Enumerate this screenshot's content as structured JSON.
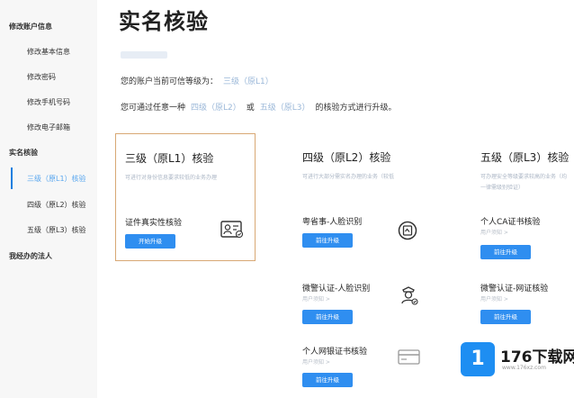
{
  "sidebar": {
    "groups": [
      {
        "label": "修改账户信息"
      },
      {
        "label": "实名核验"
      },
      {
        "label": "我经办的法人"
      }
    ],
    "account_items": [
      {
        "label": "修改基本信息"
      },
      {
        "label": "修改密码"
      },
      {
        "label": "修改手机号码"
      },
      {
        "label": "修改电子邮箱"
      }
    ],
    "verify_items": [
      {
        "label": "三级（原L1）核验"
      },
      {
        "label": "四级（原L2）核验"
      },
      {
        "label": "五级（原L3）核验"
      }
    ]
  },
  "main": {
    "title": "实名核验",
    "line1_prefix": "您的账户当前可信等级为：",
    "line1_level": "三级（原L1）",
    "line2_prefix": "您可通过任意一种",
    "line2_opt1": "四级（原L2）",
    "line2_or": "或",
    "line2_opt2": "五级（原L3）",
    "line2_suffix": "的核验方式进行升级。"
  },
  "cards": {
    "l1": {
      "title": "三级（原L1）核验",
      "desc": "可进行对身份信息要求较低的业务办理",
      "method": "证件真实性核验",
      "button": "开始升级"
    },
    "l2": {
      "title": "四级（原L2）核验",
      "desc": "可进行大部分需实名办理的业务（较低",
      "methods": [
        {
          "label": "粤省事-人脸识别",
          "sub": "",
          "button": "前往升级"
        },
        {
          "label": "微警认证-人脸识别",
          "sub": "用户须知 >",
          "button": "前往升级"
        },
        {
          "label": "个人网银证书核验",
          "sub": "用户须知 >",
          "button": "前往升级"
        }
      ]
    },
    "l3": {
      "title": "五级（原L3）核验",
      "desc": "可办理安全等级要求较高的业务（均",
      "desc2": "一律需级别验证）",
      "methods": [
        {
          "label": "个人CA证书核验",
          "sub": "用户须知 >",
          "button": "前往升级"
        },
        {
          "label": "微警认证-网证核验",
          "sub": "用户须知 >",
          "button": "前往升级"
        }
      ]
    }
  },
  "watermark": {
    "logo": "1",
    "brand": "176下载网",
    "url": "www.176xz.com"
  },
  "colors": {
    "accent": "#2f8ef0",
    "card_highlight_border": "#d8a874",
    "sidebar_bg": "#f7f7f7"
  }
}
